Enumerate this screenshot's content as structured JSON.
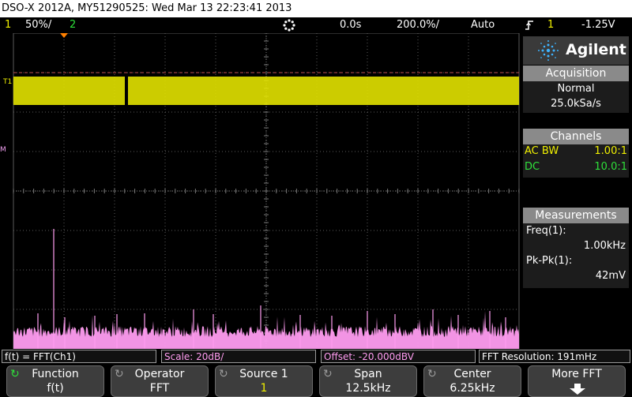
{
  "title_bar": "DSO-X 2012A, MY51290525: Wed Mar 13 22:23:41 2013",
  "status": {
    "ch1_num": "1",
    "ch1_scale": "50%/",
    "ch2_num": "2",
    "time_offset": "0.0s",
    "timebase": "200.0%/",
    "trigger_mode": "Auto",
    "trigger_icon": "trigger-edge-icon",
    "trigger_source": "1",
    "trigger_level": "-1.25V"
  },
  "side": {
    "brand": "Agilent",
    "acquisition": {
      "title": "Acquisition",
      "mode": "Normal",
      "rate": "25.0kSa/s"
    },
    "channels": {
      "title": "Channels",
      "rows": [
        {
          "label": "AC BW",
          "value": "1.00:1",
          "color": "#f0f000"
        },
        {
          "label": "DC",
          "value": "10.0:1",
          "color": "#2ee03a"
        }
      ]
    },
    "measurements": {
      "title": "Measurements",
      "freq_label": "Freq(1):",
      "freq_value": "1.00kHz",
      "pkpk_label": "Pk-Pk(1):",
      "pkpk_value": "42mV"
    }
  },
  "info": {
    "function": "f(t) = FFT(Ch1)",
    "scale": "Scale: 20dB/",
    "offset": "Offset: -20.000dBV",
    "resolution": "FFT Resolution: 191mHz"
  },
  "softkeys": [
    {
      "l1": "Function",
      "l2": "f(t)",
      "rot": true
    },
    {
      "l1": "Operator",
      "l2": "FFT",
      "rot": true
    },
    {
      "l1": "Source 1",
      "l2": "1",
      "rot": true
    },
    {
      "l1": "Span",
      "l2": "12.5kHz",
      "rot": true
    },
    {
      "l1": "Center",
      "l2": "6.25kHz",
      "rot": true
    },
    {
      "l1": "More FFT",
      "l2": "",
      "rot": false
    }
  ],
  "markers": {
    "ch1_marker": "T1",
    "math_marker": "M"
  },
  "colors": {
    "ch1": "#f0f000",
    "ch2": "#2ee03a",
    "math": "#ff9cf0",
    "grid": "#5a5a5a",
    "trigger": "#ff8000"
  }
}
